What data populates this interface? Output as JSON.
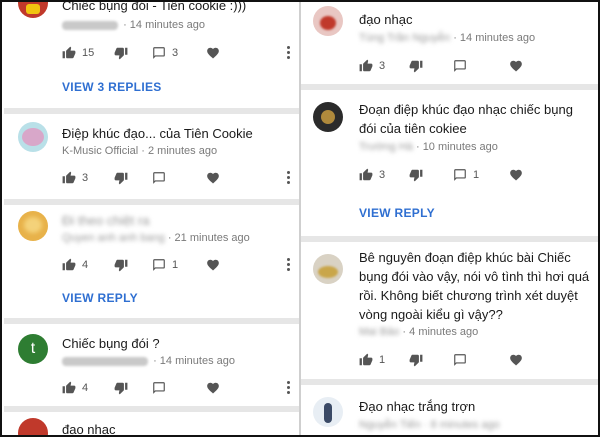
{
  "left": {
    "c1": {
      "text": "Chiếc bụng đói - Tiên cookie :)))",
      "time": "· 14 minutes ago",
      "likes": "15",
      "replies_count": "3",
      "view_replies": "VIEW 3 REPLIES"
    },
    "c2": {
      "text": "Điệp khúc đạo... của Tiên Cookie",
      "author": "K-Music Official",
      "time": "· 2 minutes ago",
      "likes": "3"
    },
    "c3": {
      "text_blurred": "Đi theo chiệt ra",
      "author_blurred": "Quyen anh anh bang",
      "time": "· 21 minutes ago",
      "likes": "4",
      "replies_count": "1",
      "view_reply": "VIEW REPLY"
    },
    "c4": {
      "avatar_letter": "t",
      "text": "Chiếc bụng đói ?",
      "time": "· 14 minutes ago",
      "likes": "4"
    },
    "c5": {
      "text": "đạo nhạc"
    }
  },
  "right": {
    "c1": {
      "text": "đạo nhạc",
      "author_blurred": "Tùng Trần Nguyễn",
      "time": "· 14 minutes ago",
      "likes": "3"
    },
    "c2": {
      "text": "Đoạn điệp khúc đạo nhạc chiếc bụng đói của tiên cokiee",
      "author_blurred": "Trường Hà",
      "time": "· 10 minutes ago",
      "likes": "3",
      "replies_count": "1",
      "view_reply": "VIEW REPLY"
    },
    "c3": {
      "text": "Bê nguyên đoạn điệp khúc bài Chiếc bụng đói vào vậy, nói vô tình thì hơi quá rồi. Không biết chương trình xét duyệt vòng ngoài kiểu gì vậy??",
      "author_blurred": "Mai Bảo",
      "time": "· 4 minutes ago",
      "likes": "1"
    },
    "c4": {
      "text": "Đạo nhạc trắng trợn",
      "author_blurred": "Nguyễn Tiến",
      "time": "· 8 minutes ago"
    }
  },
  "colors": {
    "link": "#2f6fd1",
    "icon": "#555555",
    "separator": "#e6e6e6"
  },
  "icons": [
    "thumb-up-icon",
    "thumb-down-icon",
    "reply-icon",
    "heart-icon",
    "more-vert-icon"
  ]
}
